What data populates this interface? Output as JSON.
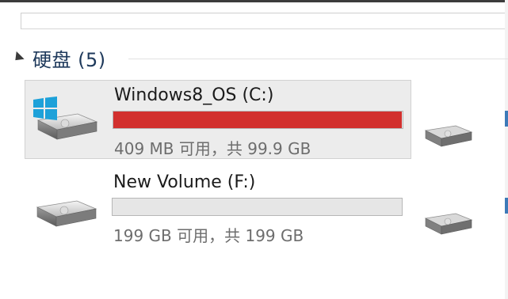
{
  "section": {
    "title": "硬盘 (5)"
  },
  "colors": {
    "critical_fill": "#d2302e",
    "normal_fill": "#2d8fd6",
    "bar_track": "#e6e6e6",
    "windows_logo": "#1da1d9"
  },
  "drives": [
    {
      "name": "Windows8_OS (C:)",
      "space_text": "409 MB 可用，共 99.9 GB",
      "used_fraction": 0.996,
      "status": "critical",
      "selected": true,
      "icon": "windows-system-drive-icon"
    },
    {
      "name": "New Volume (F:)",
      "space_text": "199 GB 可用，共 199 GB",
      "used_fraction": 0.0,
      "status": "normal",
      "selected": false,
      "icon": "hard-drive-icon"
    }
  ],
  "partial_items": [
    {
      "icon": "hard-drive-icon"
    },
    {
      "icon": "hard-drive-icon"
    }
  ]
}
